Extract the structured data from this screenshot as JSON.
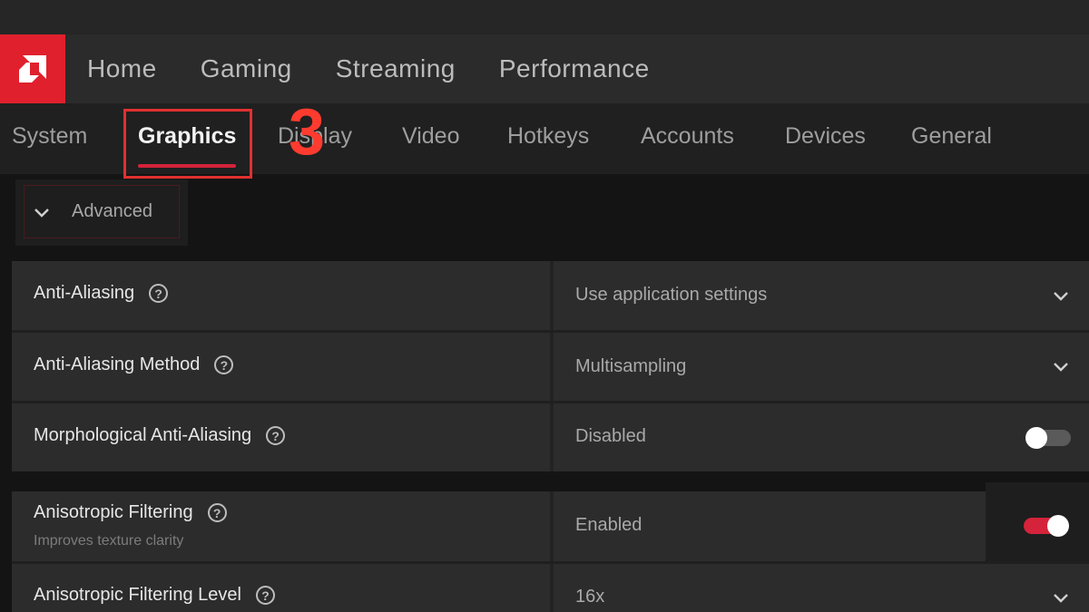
{
  "nav": {
    "main": [
      "Home",
      "Gaming",
      "Streaming",
      "Performance"
    ],
    "sub": [
      "System",
      "Graphics",
      "Display",
      "Video",
      "Hotkeys",
      "Accounts",
      "Devices",
      "General"
    ],
    "active_sub": "Graphics"
  },
  "annotation": {
    "step": "3"
  },
  "advanced": {
    "label": "Advanced"
  },
  "settings": {
    "anti_aliasing": {
      "label": "Anti-Aliasing",
      "value": "Use application settings"
    },
    "aa_method": {
      "label": "Anti-Aliasing Method",
      "value": "Multisampling"
    },
    "morph_aa": {
      "label": "Morphological Anti-Aliasing",
      "value": "Disabled",
      "toggle": false
    },
    "aniso": {
      "label": "Anisotropic Filtering",
      "sublabel": "Improves texture clarity",
      "value": "Enabled",
      "toggle": true
    },
    "aniso_level": {
      "label": "Anisotropic Filtering Level",
      "value": "16x"
    }
  },
  "colors": {
    "accent": "#e0202d",
    "toggle_on": "#d4233a",
    "toggle_off": "#5a5a5a",
    "annotation": "#ff3b2f"
  },
  "icons": {
    "logo": "amd-logo-icon",
    "help": "question-circle-icon",
    "dropdown": "chevron-down-icon"
  }
}
